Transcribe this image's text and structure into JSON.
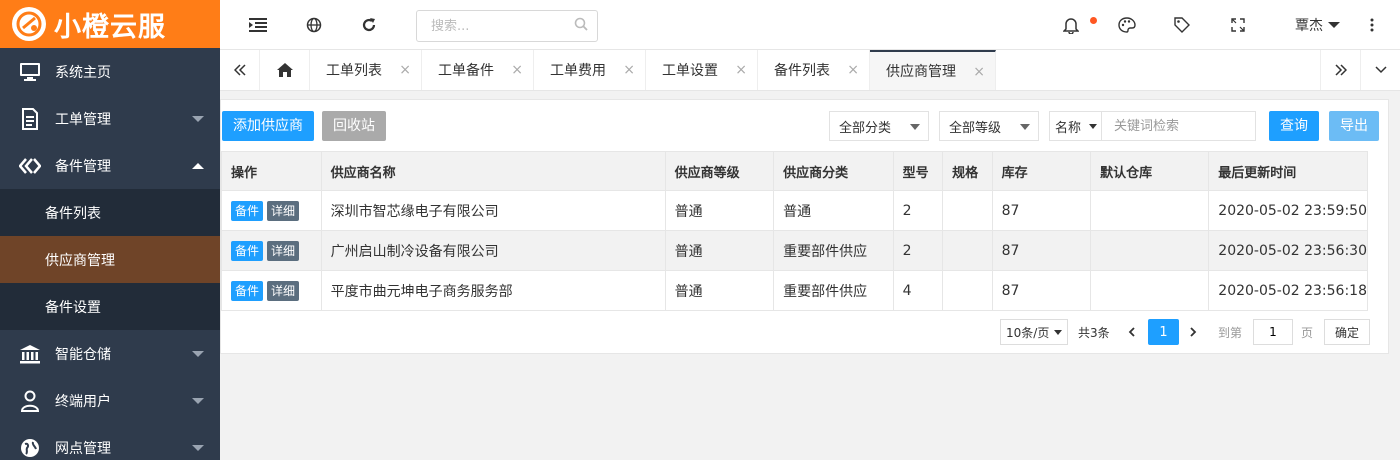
{
  "brand": {
    "name": "小橙云服",
    "color": "#ff7d17"
  },
  "sidebar": {
    "items": [
      {
        "label": "系统主页",
        "icon": "monitor-icon"
      },
      {
        "label": "工单管理",
        "icon": "document-icon"
      },
      {
        "label": "备件管理",
        "icon": "parts-icon",
        "expanded": true,
        "children": [
          {
            "label": "备件列表"
          },
          {
            "label": "供应商管理",
            "active": true
          },
          {
            "label": "备件设置"
          }
        ]
      },
      {
        "label": "智能仓储",
        "icon": "bank-icon"
      },
      {
        "label": "终端用户",
        "icon": "user-icon"
      },
      {
        "label": "网点管理",
        "icon": "globe-icon"
      }
    ]
  },
  "header": {
    "search_placeholder": "搜索...",
    "user_name": "覃杰",
    "icons": [
      "menu-toggle-icon",
      "globe-icon",
      "refresh-icon",
      "search-icon",
      "bell-icon",
      "palette-icon",
      "tag-icon",
      "fullscreen-icon",
      "more-icon"
    ],
    "notification_dot_color": "#ff5722"
  },
  "tabs": [
    {
      "label": "工单列表"
    },
    {
      "label": "工单备件"
    },
    {
      "label": "工单费用"
    },
    {
      "label": "工单设置"
    },
    {
      "label": "备件列表"
    },
    {
      "label": "供应商管理",
      "active": true
    }
  ],
  "tab_close_glyph": "×",
  "toolbar": {
    "add_label": "添加供应商",
    "recycle_label": "回收站",
    "category_filter": "全部分类",
    "level_filter": "全部等级",
    "field_select": "名称",
    "keyword_placeholder": "关键词检索",
    "query_label": "查询",
    "export_label": "导出",
    "colors": {
      "primary": "#1e9fff",
      "gray": "#aaaaaa",
      "export": "#6cbcf5"
    }
  },
  "table": {
    "columns": [
      "操作",
      "供应商名称",
      "供应商等级",
      "供应商分类",
      "型号",
      "规格",
      "库存",
      "默认仓库",
      "最后更新时间"
    ],
    "row_buttons": {
      "parts": "备件",
      "detail": "详细"
    },
    "rows": [
      {
        "name": "深圳市智芯缘电子有限公司",
        "level": "普通",
        "category": "普通",
        "model": "2",
        "spec": "",
        "stock": "87",
        "warehouse": "",
        "updated": "2020-05-02 23:59:50"
      },
      {
        "name": "广州启山制冷设备有限公司",
        "level": "普通",
        "category": "重要部件供应",
        "model": "2",
        "spec": "",
        "stock": "87",
        "warehouse": "",
        "updated": "2020-05-02 23:56:30"
      },
      {
        "name": "平度市曲元坤电子商务服务部",
        "level": "普通",
        "category": "重要部件供应",
        "model": "4",
        "spec": "",
        "stock": "87",
        "warehouse": "",
        "updated": "2020-05-02 23:56:18"
      }
    ]
  },
  "pager": {
    "page_size": "10条/页",
    "total": "共3条",
    "current": "1",
    "goto_label": "到第",
    "goto_value": "1",
    "page_unit": "页",
    "confirm": "确定"
  }
}
